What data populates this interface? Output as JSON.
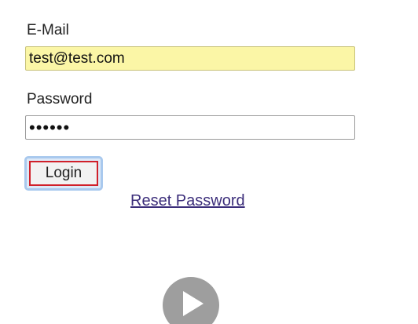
{
  "form": {
    "email_label": "E-Mail",
    "email_value": "test@test.com",
    "password_label": "Password",
    "password_value": "••••••",
    "login_label": "Login",
    "reset_label": "Reset Password"
  },
  "video": {
    "play_icon": "play-icon"
  },
  "colors": {
    "email_autofill_bg": "#fbf6a6",
    "login_focus_border": "#d0202a",
    "focus_ring": "#a9c9ee",
    "link": "#3b2d7a",
    "play_button": "#9e9e9e"
  }
}
